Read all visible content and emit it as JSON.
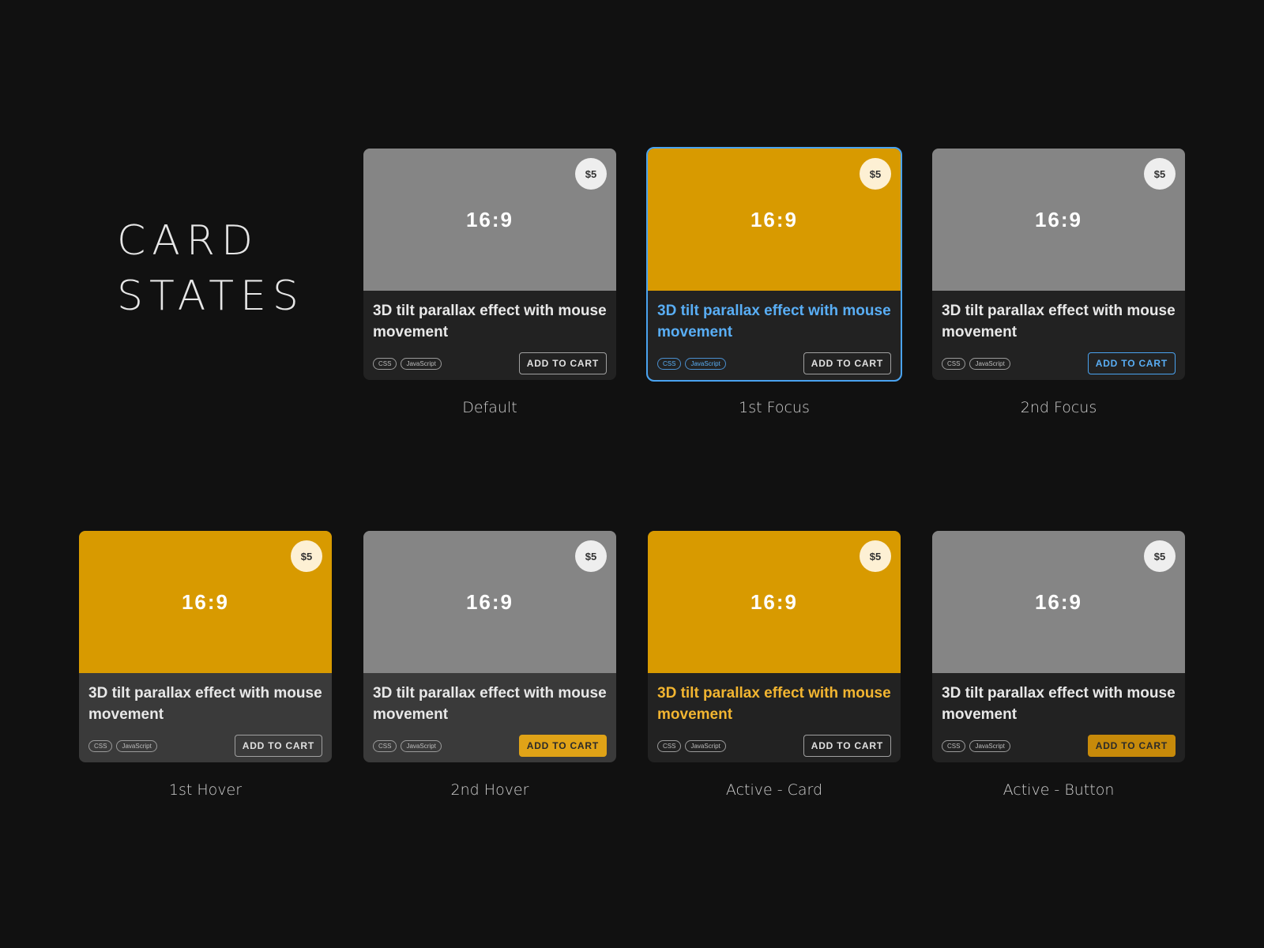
{
  "heading": {
    "line1": "CARD",
    "line2": "STATES"
  },
  "common": {
    "ratio": "16:9",
    "price": "$5",
    "title": "3D tilt parallax effect with mouse movement",
    "tags": [
      "CSS",
      "JavaScript"
    ],
    "button": "ADD TO CART"
  },
  "states": {
    "default": "Default",
    "first_focus": "1st Focus",
    "second_focus": "2nd Focus",
    "first_hover": "1st Hover",
    "second_hover": "2nd Hover",
    "active_card": "Active - Card",
    "active_button": "Active - Button"
  },
  "colors": {
    "background": "#111111",
    "card": "#222222",
    "card_hover": "#3a3a3a",
    "thumb_gray": "#858585",
    "thumb_gold": "#d89a00",
    "focus_blue": "#4aa3f0",
    "gold_text": "#f2b531"
  }
}
